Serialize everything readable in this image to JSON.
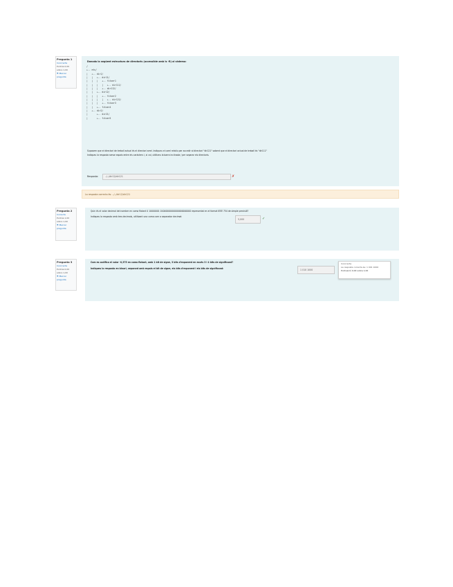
{
  "q1": {
    "info": {
      "number": "Pregunta 1",
      "status": "Incorrecta",
      "score": "Puntúa 0,00",
      "score_of": "sobre 1,00",
      "flag": "Marcar pregunta"
    },
    "prompt": "Donada la següent estructura de directoris (accessible amb ls -R) al sistema:",
    "tree": [
      "/",
      "+-- etc/",
      "|   +-- dir1/",
      "|   |   +-- dir11/",
      "|   |   |   +-- fitxer1",
      "|   |   |   |   +-- dir111/",
      "|   |   |   +-- dir112/",
      "|   |   +-- dir12/",
      "|   |   |   +-- fitxer2",
      "|   |   |   |   +-- dir121/",
      "|   |   |   +-- fitxer3",
      "|   |   +-- fitxer4",
      "|   +-- dir2/",
      "|       +-- dir21/",
      "|       +-- fitxer5"
    ],
    "instruction_1": "Suposem que el directori de treball actual és el directori arrel. Indiqueu el camí relatiu per accedir al directori \"dir121\" sabent que el directori actual de treball és \"dir111\"",
    "instruction_2": "Indiqueu la resposta sense espais entre els caràcters i, si cal, utilitzeu la barra inclinada / per separar els directoris.",
    "answer_label": "Resposta:",
    "answer_value": "../../dir12/dir121",
    "mark": "✗",
    "feedback": "La resposta correcta és: ../../dir12/dir121"
  },
  "q2": {
    "info": {
      "number": "Pregunta 2",
      "status": "Correcta",
      "score": "Puntúa 1,00",
      "score_of": "sobre 1,00",
      "flag": "Marcar pregunta"
    },
    "line_1": "Quin és el valor decimal del nombre en coma flotant 0 10000001 01000000000000000000000 representat en el format IEEE 754 de simple precisió?",
    "line_2": "Indiqueu la resposta amb tres decimals, utilitzant una coma com a separador decimal:",
    "answer_value": "5,000",
    "mark": "✓"
  },
  "q3": {
    "info": {
      "number": "Pregunta 3",
      "status": "Incorrecta",
      "score": "Puntúa 0,00",
      "score_of": "sobre 1,00",
      "flag": "Marcar pregunta"
    },
    "line_1": "Com es codifica el valor -0,375 en coma flotant, amb 1 bit de signe, 3 bits d'exponent en excés 3 i 4 bits de significand?",
    "line_2": "Indiqueu la resposta en binari, separant amb espais el bit de signe, els bits d'exponent i els bits de significand:",
    "answer_value": "1 010 1000",
    "popup": {
      "label": "Incorrecte",
      "line": "La resposta correcta és: 1 001 1000",
      "score": "Puntuació 0,00 sobre 1,00"
    }
  }
}
